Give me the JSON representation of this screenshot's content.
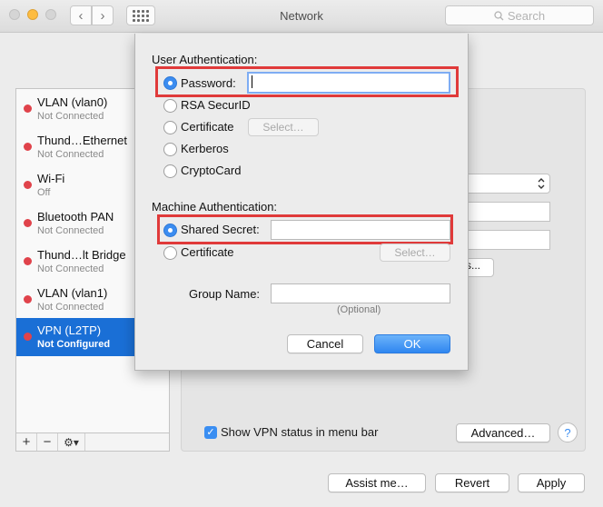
{
  "window": {
    "title": "Network"
  },
  "toolbar": {
    "search_placeholder": "Search"
  },
  "sidebar": {
    "services": [
      {
        "name": "VLAN (vlan0)",
        "status": "Not Connected"
      },
      {
        "name": "Thund…Ethernet",
        "status": "Not Connected"
      },
      {
        "name": "Wi-Fi",
        "status": "Off"
      },
      {
        "name": "Bluetooth PAN",
        "status": "Not Connected"
      },
      {
        "name": "Thund…lt Bridge",
        "status": "Not Connected"
      },
      {
        "name": "VLAN (vlan1)",
        "status": "Not Connected"
      },
      {
        "name": "VPN (L2TP)",
        "status": "Not Configured"
      }
    ],
    "selected_index": 6
  },
  "detail": {
    "show_vpn_status_label": "Show VPN status in menu bar",
    "show_vpn_status_checked": true,
    "advanced_label": "Advanced…",
    "help_label": "?",
    "partial_button_label": "s..."
  },
  "footer": {
    "assist_label": "Assist me…",
    "revert_label": "Revert",
    "apply_label": "Apply"
  },
  "sheet": {
    "user_auth_heading": "User Authentication:",
    "user_options": [
      {
        "label": "Password:",
        "selected": true
      },
      {
        "label": "RSA SecurID",
        "selected": false
      },
      {
        "label": "Certificate",
        "selected": false
      },
      {
        "label": "Kerberos",
        "selected": false
      },
      {
        "label": "CryptoCard",
        "selected": false
      }
    ],
    "password_value": "",
    "select_label": "Select…",
    "machine_auth_heading": "Machine Authentication:",
    "machine_options": [
      {
        "label": "Shared Secret:",
        "selected": true
      },
      {
        "label": "Certificate",
        "selected": false
      }
    ],
    "shared_secret_value": "",
    "group_name_label": "Group Name:",
    "group_name_value": "",
    "optional_hint": "(Optional)",
    "cancel_label": "Cancel",
    "ok_label": "OK"
  },
  "colors": {
    "accent": "#3b8cf0",
    "selection": "#1a6fd6",
    "status_red": "#e0434b",
    "highlight": "#e03a3a"
  }
}
